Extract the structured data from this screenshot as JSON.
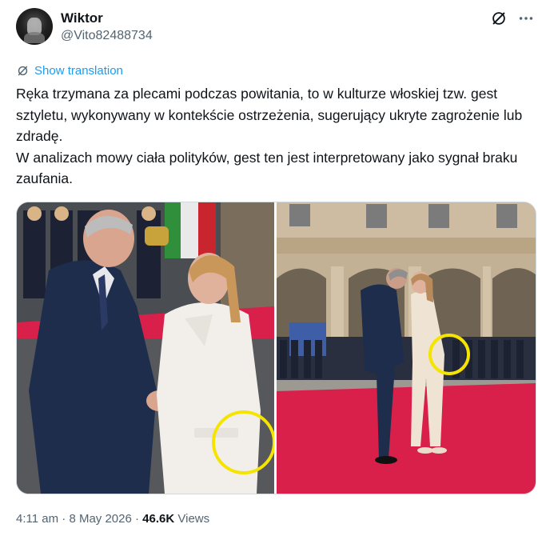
{
  "author": {
    "name": "Wiktor",
    "handle": "@Vito82488734"
  },
  "icons": [
    "grok-icon",
    "more-icon",
    "translate-icon"
  ],
  "translation": {
    "label": "Show translation"
  },
  "tweet": {
    "lines": [
      "Ręka trzymana za plecami podczas powitania, to w kulturze włoskiej tzw. gest sztyletu, wykonywany w kontekście ostrzeżenia, sugerujący ukryte zagrożenie lub zdradę.",
      "W analizach mowy ciała polityków, gest ten jest interpretowany jako sygnał braku zaufania."
    ]
  },
  "meta": {
    "time": "4:11 am",
    "separator": "·",
    "date": "8 May 2026",
    "views_count": "46.6K",
    "views_label": "Views"
  },
  "colors": {
    "link": "#1d9bf0",
    "highlight_circle": "#f5e400",
    "carpet": "#d8204a"
  }
}
